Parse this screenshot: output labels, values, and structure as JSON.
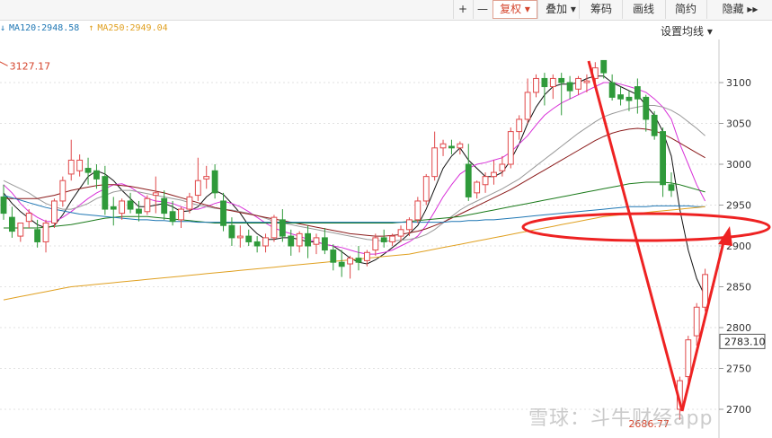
{
  "toolbar": {
    "buttons": [
      "+",
      "—",
      "复权 ▾",
      "叠加 ▾",
      "筹码",
      "画线",
      "简约",
      "隐藏 ▸▸"
    ]
  },
  "ma_legend": [
    {
      "label": "MA120:2948.58",
      "arrow": "↓",
      "color": "#1f77b4"
    },
    {
      "label": "MA250:2949.04",
      "arrow": "↑",
      "color": "#e0a020"
    }
  ],
  "setting_label": "设置均线 ▾",
  "watermark": "雪球：斗牛财经app",
  "chart_data": {
    "type": "candlestick",
    "ylim": [
      2680,
      3150
    ],
    "y_ticks": [
      2700,
      2750,
      2800,
      2850,
      2900,
      2950,
      3000,
      3050,
      3100
    ],
    "last_price_label": "2783.10",
    "high_annotation": "3127.17",
    "low_annotation": "2686.77",
    "colors": {
      "up": "#e0484a",
      "down": "#2f9a3a",
      "ma5": "#111111",
      "ma10": "#d830d8",
      "ma20": "#999999",
      "ma30": "#8b1a1a",
      "ma60": "#1a7a1a",
      "ma120": "#1f77b4",
      "ma250": "#e0a020",
      "annotation": "#ee2222"
    },
    "candles": [
      {
        "o": 2960,
        "h": 2975,
        "c": 2940,
        "l": 2932
      },
      {
        "o": 2935,
        "h": 2948,
        "c": 2918,
        "l": 2910
      },
      {
        "o": 2912,
        "h": 2928,
        "c": 2928,
        "l": 2905
      },
      {
        "o": 2930,
        "h": 2945,
        "c": 2940,
        "l": 2922
      },
      {
        "o": 2920,
        "h": 2932,
        "c": 2905,
        "l": 2898
      },
      {
        "o": 2905,
        "h": 2932,
        "c": 2928,
        "l": 2892
      },
      {
        "o": 2928,
        "h": 2958,
        "c": 2955,
        "l": 2922
      },
      {
        "o": 2955,
        "h": 2985,
        "c": 2980,
        "l": 2948
      },
      {
        "o": 2988,
        "h": 3030,
        "c": 3005,
        "l": 2980
      },
      {
        "o": 2992,
        "h": 3012,
        "c": 3005,
        "l": 2985
      },
      {
        "o": 2995,
        "h": 3008,
        "c": 2990,
        "l": 2975
      },
      {
        "o": 2992,
        "h": 3000,
        "c": 2982,
        "l": 2970
      },
      {
        "o": 2985,
        "h": 2998,
        "c": 2945,
        "l": 2938
      },
      {
        "o": 2948,
        "h": 2960,
        "c": 2945,
        "l": 2925
      },
      {
        "o": 2940,
        "h": 2958,
        "c": 2955,
        "l": 2932
      },
      {
        "o": 2955,
        "h": 2965,
        "c": 2945,
        "l": 2940
      },
      {
        "o": 2945,
        "h": 2955,
        "c": 2940,
        "l": 2930
      },
      {
        "o": 2942,
        "h": 2962,
        "c": 2958,
        "l": 2938
      },
      {
        "o": 2962,
        "h": 2985,
        "c": 2965,
        "l": 2940
      },
      {
        "o": 2958,
        "h": 2968,
        "c": 2940,
        "l": 2932
      },
      {
        "o": 2942,
        "h": 2955,
        "c": 2930,
        "l": 2925
      },
      {
        "o": 2932,
        "h": 2948,
        "c": 2945,
        "l": 2922
      },
      {
        "o": 2945,
        "h": 2965,
        "c": 2960,
        "l": 2940
      },
      {
        "o": 2962,
        "h": 3008,
        "c": 2980,
        "l": 2955
      },
      {
        "o": 2982,
        "h": 2998,
        "c": 2985,
        "l": 2970
      },
      {
        "o": 2992,
        "h": 3000,
        "c": 2965,
        "l": 2958
      },
      {
        "o": 2955,
        "h": 2965,
        "c": 2925,
        "l": 2918
      },
      {
        "o": 2925,
        "h": 2935,
        "c": 2910,
        "l": 2900
      },
      {
        "o": 2910,
        "h": 2925,
        "c": 2912,
        "l": 2898
      },
      {
        "o": 2912,
        "h": 2920,
        "c": 2905,
        "l": 2900
      },
      {
        "o": 2905,
        "h": 2912,
        "c": 2900,
        "l": 2892
      },
      {
        "o": 2900,
        "h": 2915,
        "c": 2910,
        "l": 2892
      },
      {
        "o": 2910,
        "h": 2938,
        "c": 2935,
        "l": 2905
      },
      {
        "o": 2932,
        "h": 2945,
        "c": 2912,
        "l": 2905
      },
      {
        "o": 2912,
        "h": 2920,
        "c": 2900,
        "l": 2888
      },
      {
        "o": 2900,
        "h": 2918,
        "c": 2915,
        "l": 2892
      },
      {
        "o": 2915,
        "h": 2925,
        "c": 2900,
        "l": 2885
      },
      {
        "o": 2902,
        "h": 2915,
        "c": 2910,
        "l": 2890
      },
      {
        "o": 2910,
        "h": 2922,
        "c": 2895,
        "l": 2890
      },
      {
        "o": 2895,
        "h": 2902,
        "c": 2880,
        "l": 2870
      },
      {
        "o": 2880,
        "h": 2895,
        "c": 2875,
        "l": 2862
      },
      {
        "o": 2878,
        "h": 2888,
        "c": 2885,
        "l": 2860
      },
      {
        "o": 2885,
        "h": 2900,
        "c": 2880,
        "l": 2870
      },
      {
        "o": 2882,
        "h": 2895,
        "c": 2892,
        "l": 2875
      },
      {
        "o": 2895,
        "h": 2915,
        "c": 2910,
        "l": 2888
      },
      {
        "o": 2910,
        "h": 2920,
        "c": 2905,
        "l": 2898
      },
      {
        "o": 2905,
        "h": 2915,
        "c": 2912,
        "l": 2900
      },
      {
        "o": 2912,
        "h": 2925,
        "c": 2920,
        "l": 2905
      },
      {
        "o": 2920,
        "h": 2935,
        "c": 2932,
        "l": 2912
      },
      {
        "o": 2932,
        "h": 2960,
        "c": 2955,
        "l": 2928
      },
      {
        "o": 2955,
        "h": 2988,
        "c": 2985,
        "l": 2950
      },
      {
        "o": 2985,
        "h": 3040,
        "c": 3020,
        "l": 2980
      },
      {
        "o": 3020,
        "h": 3030,
        "c": 3025,
        "l": 3010
      },
      {
        "o": 3022,
        "h": 3030,
        "c": 3020,
        "l": 3012
      },
      {
        "o": 3020,
        "h": 3028,
        "c": 3025,
        "l": 3012
      },
      {
        "o": 3000,
        "h": 3025,
        "c": 2960,
        "l": 2955
      },
      {
        "o": 2965,
        "h": 2980,
        "c": 2978,
        "l": 2958
      },
      {
        "o": 2975,
        "h": 2990,
        "c": 2985,
        "l": 2965
      },
      {
        "o": 2985,
        "h": 3005,
        "c": 2990,
        "l": 2975
      },
      {
        "o": 2992,
        "h": 3010,
        "c": 3000,
        "l": 2985
      },
      {
        "o": 3000,
        "h": 3045,
        "c": 3040,
        "l": 2995
      },
      {
        "o": 3040,
        "h": 3060,
        "c": 3055,
        "l": 3030
      },
      {
        "o": 3055,
        "h": 3105,
        "c": 3088,
        "l": 3050
      },
      {
        "o": 3088,
        "h": 3110,
        "c": 3105,
        "l": 3082
      },
      {
        "o": 3105,
        "h": 3112,
        "c": 3095,
        "l": 3072
      },
      {
        "o": 3095,
        "h": 3110,
        "c": 3105,
        "l": 3080
      },
      {
        "o": 3105,
        "h": 3112,
        "c": 3100,
        "l": 3060
      },
      {
        "o": 3100,
        "h": 3108,
        "c": 3090,
        "l": 3080
      },
      {
        "o": 3092,
        "h": 3108,
        "c": 3105,
        "l": 3085
      },
      {
        "o": 3100,
        "h": 3110,
        "c": 3102,
        "l": 3088
      },
      {
        "o": 3105,
        "h": 3125,
        "c": 3118,
        "l": 3098
      },
      {
        "o": 3127,
        "h": 3127,
        "c": 3112,
        "l": 3105
      },
      {
        "o": 3100,
        "h": 3110,
        "c": 3082,
        "l": 3078
      },
      {
        "o": 3085,
        "h": 3095,
        "c": 3080,
        "l": 3072
      },
      {
        "o": 3082,
        "h": 3090,
        "c": 3078,
        "l": 3065
      },
      {
        "o": 3095,
        "h": 3105,
        "c": 3080,
        "l": 3062
      },
      {
        "o": 3082,
        "h": 3085,
        "c": 3055,
        "l": 3040
      },
      {
        "o": 3060,
        "h": 3065,
        "c": 3035,
        "l": 3030
      },
      {
        "o": 3040,
        "h": 3045,
        "c": 2975,
        "l": 2960
      },
      {
        "o": 2975,
        "h": 2990,
        "c": 2968,
        "l": 2960
      },
      {
        "o": 2700,
        "h": 2740,
        "c": 2735,
        "l": 2687
      },
      {
        "o": 2740,
        "h": 2790,
        "c": 2785,
        "l": 2730
      },
      {
        "o": 2790,
        "h": 2830,
        "c": 2825,
        "l": 2778
      },
      {
        "o": 2825,
        "h": 2872,
        "c": 2865,
        "l": 2820
      }
    ],
    "ma_lines": [
      {
        "key": "ma5",
        "values": [
          2965,
          2952,
          2942,
          2934,
          2926,
          2922,
          2925,
          2938,
          2955,
          2970,
          2985,
          2992,
          2988,
          2980,
          2968,
          2958,
          2948,
          2948,
          2950,
          2952,
          2948,
          2942,
          2943,
          2948,
          2960,
          2968,
          2963,
          2952,
          2940,
          2925,
          2915,
          2908,
          2908,
          2910,
          2910,
          2908,
          2905,
          2905,
          2902,
          2900,
          2893,
          2885,
          2880,
          2878,
          2883,
          2890,
          2898,
          2906,
          2915,
          2925,
          2945,
          2970,
          2995,
          3010,
          3020,
          3005,
          2995,
          2985,
          2985,
          2990,
          3005,
          3025,
          3050,
          3070,
          3085,
          3095,
          3098,
          3098,
          3100,
          3105,
          3108,
          3108,
          3100,
          3095,
          3090,
          3085,
          3072,
          3060,
          3040,
          3010,
          2945,
          2895,
          2860,
          2838
        ]
      },
      {
        "key": "ma10",
        "values": [
          2975,
          2965,
          2952,
          2942,
          2935,
          2930,
          2930,
          2935,
          2942,
          2950,
          2958,
          2965,
          2970,
          2975,
          2976,
          2972,
          2965,
          2958,
          2955,
          2954,
          2952,
          2948,
          2945,
          2945,
          2948,
          2952,
          2955,
          2952,
          2948,
          2942,
          2935,
          2928,
          2922,
          2918,
          2915,
          2912,
          2908,
          2905,
          2902,
          2900,
          2898,
          2895,
          2892,
          2890,
          2890,
          2892,
          2895,
          2900,
          2905,
          2912,
          2925,
          2942,
          2960,
          2975,
          2988,
          2995,
          3000,
          3002,
          3005,
          3008,
          3015,
          3025,
          3035,
          3048,
          3060,
          3068,
          3075,
          3080,
          3085,
          3090,
          3095,
          3100,
          3100,
          3098,
          3095,
          3092,
          3088,
          3080,
          3070,
          3055,
          3025,
          3000,
          2975,
          2955
        ]
      },
      {
        "key": "ma20",
        "values": [
          2980,
          2975,
          2970,
          2965,
          2958,
          2952,
          2948,
          2945,
          2945,
          2948,
          2952,
          2958,
          2962,
          2966,
          2968,
          2968,
          2966,
          2964,
          2962,
          2960,
          2958,
          2956,
          2953,
          2950,
          2948,
          2946,
          2945,
          2944,
          2942,
          2940,
          2937,
          2934,
          2930,
          2928,
          2926,
          2924,
          2922,
          2920,
          2918,
          2916,
          2914,
          2912,
          2910,
          2908,
          2907,
          2906,
          2906,
          2907,
          2908,
          2910,
          2914,
          2920,
          2928,
          2936,
          2944,
          2950,
          2955,
          2960,
          2965,
          2970,
          2976,
          2982,
          2990,
          2998,
          3006,
          3014,
          3022,
          3030,
          3038,
          3045,
          3052,
          3058,
          3062,
          3065,
          3068,
          3070,
          3072,
          3072,
          3070,
          3066,
          3060,
          3052,
          3044,
          3035
        ]
      },
      {
        "key": "ma30",
        "values": [
          2958,
          2958,
          2958,
          2958,
          2958,
          2960,
          2962,
          2965,
          2968,
          2970,
          2972,
          2974,
          2975,
          2975,
          2974,
          2973,
          2971,
          2969,
          2967,
          2965,
          2962,
          2959,
          2956,
          2953,
          2950,
          2947,
          2945,
          2943,
          2941,
          2939,
          2937,
          2935,
          2933,
          2931,
          2929,
          2927,
          2925,
          2923,
          2921,
          2919,
          2917,
          2915,
          2914,
          2913,
          2912,
          2912,
          2913,
          2914,
          2916,
          2918,
          2921,
          2925,
          2929,
          2934,
          2939,
          2944,
          2949,
          2954,
          2959,
          2964,
          2969,
          2975,
          2981,
          2987,
          2993,
          2999,
          3005,
          3011,
          3017,
          3023,
          3029,
          3034,
          3038,
          3041,
          3043,
          3044,
          3043,
          3041,
          3037,
          3032,
          3026,
          3020,
          3014,
          3008
        ]
      },
      {
        "key": "ma60",
        "values": [
          2922,
          2922,
          2922,
          2922,
          2922,
          2923,
          2924,
          2925,
          2926,
          2928,
          2930,
          2932,
          2934,
          2935,
          2936,
          2936,
          2936,
          2936,
          2935,
          2934,
          2933,
          2932,
          2931,
          2930,
          2929,
          2928,
          2928,
          2928,
          2928,
          2928,
          2928,
          2928,
          2928,
          2928,
          2928,
          2928,
          2928,
          2928,
          2928,
          2928,
          2928,
          2928,
          2928,
          2928,
          2928,
          2928,
          2928,
          2929,
          2930,
          2931,
          2932,
          2933,
          2934,
          2935,
          2936,
          2938,
          2940,
          2942,
          2944,
          2946,
          2948,
          2950,
          2952,
          2954,
          2956,
          2958,
          2960,
          2962,
          2964,
          2966,
          2968,
          2970,
          2972,
          2974,
          2976,
          2977,
          2978,
          2978,
          2978,
          2977,
          2975,
          2972,
          2969,
          2966
        ]
      },
      {
        "key": "ma120",
        "values": [
          2962,
          2959,
          2956,
          2953,
          2950,
          2947,
          2945,
          2943,
          2941,
          2939,
          2938,
          2937,
          2936,
          2935,
          2934,
          2933,
          2932,
          2932,
          2931,
          2931,
          2930,
          2930,
          2930,
          2929,
          2929,
          2929,
          2929,
          2929,
          2929,
          2929,
          2929,
          2929,
          2929,
          2929,
          2929,
          2929,
          2929,
          2929,
          2929,
          2929,
          2929,
          2929,
          2929,
          2929,
          2929,
          2929,
          2929,
          2929,
          2929,
          2929,
          2929,
          2929,
          2929,
          2930,
          2930,
          2931,
          2931,
          2932,
          2932,
          2933,
          2934,
          2935,
          2936,
          2937,
          2938,
          2939,
          2940,
          2941,
          2942,
          2943,
          2944,
          2945,
          2946,
          2947,
          2948,
          2948,
          2948,
          2949,
          2949,
          2949,
          2949,
          2949,
          2948,
          2948
        ]
      },
      {
        "key": "ma250",
        "values": [
          2834,
          2836,
          2838,
          2840,
          2842,
          2844,
          2846,
          2848,
          2850,
          2851,
          2852,
          2853,
          2854,
          2855,
          2856,
          2857,
          2858,
          2859,
          2860,
          2861,
          2862,
          2863,
          2864,
          2865,
          2866,
          2867,
          2868,
          2869,
          2870,
          2871,
          2872,
          2873,
          2874,
          2875,
          2876,
          2877,
          2878,
          2879,
          2880,
          2881,
          2882,
          2883,
          2884,
          2885,
          2886,
          2887,
          2888,
          2889,
          2890,
          2892,
          2894,
          2896,
          2898,
          2900,
          2902,
          2904,
          2906,
          2908,
          2910,
          2912,
          2914,
          2916,
          2918,
          2920,
          2922,
          2924,
          2926,
          2928,
          2930,
          2932,
          2934,
          2936,
          2937,
          2938,
          2939,
          2940,
          2941,
          2942,
          2943,
          2944,
          2945,
          2946,
          2947,
          2948
        ]
      }
    ]
  }
}
